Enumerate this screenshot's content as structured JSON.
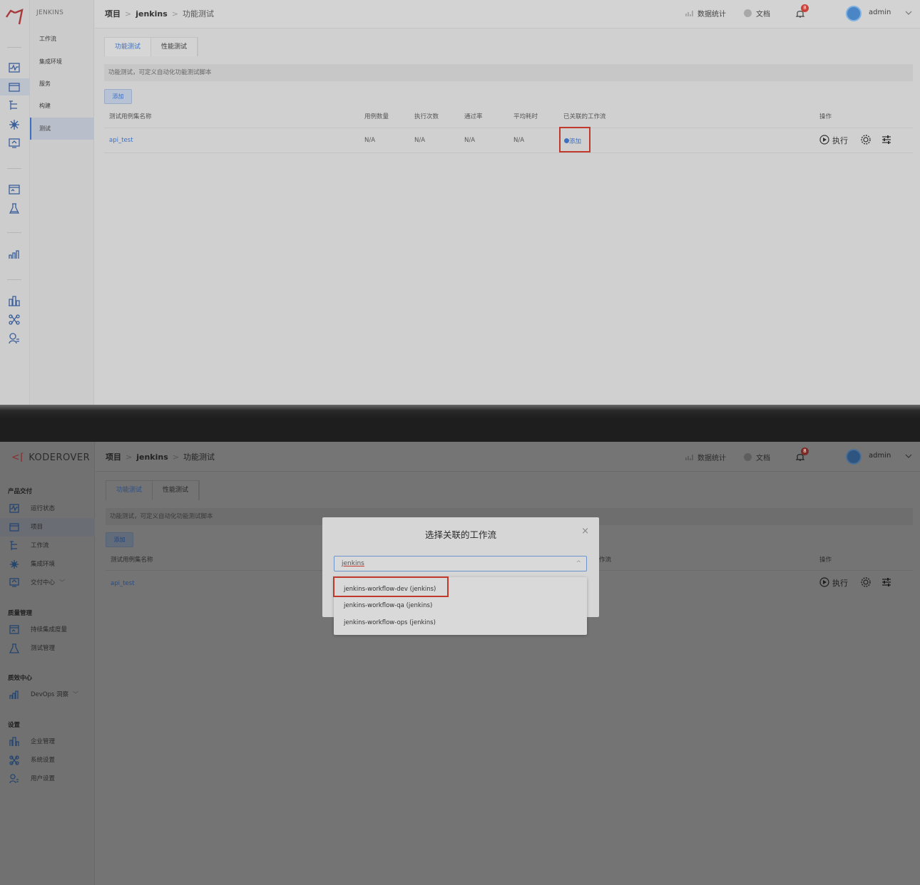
{
  "top": {
    "project_badge": "JENKINS",
    "sub_nav": [
      "工作流",
      "集成环境",
      "服务",
      "构建",
      "测试"
    ],
    "active_sub_nav": "测试",
    "breadcrumb": {
      "root": "项目",
      "project": "jenkins",
      "current": "功能测试"
    },
    "topbar": {
      "stats_label": "数据统计",
      "docs_label": "文档",
      "notification_count": "8",
      "user": "admin"
    },
    "tabs": [
      "功能测试",
      "性能测试"
    ],
    "description": "功能测试，可定义自动化功能测试脚本",
    "add_button": "添加",
    "table": {
      "headers": [
        "测试用例集名称",
        "用例数量",
        "执行次数",
        "通过率",
        "平均耗时",
        "已关联的工作流",
        "操作"
      ],
      "rows": [
        {
          "name": "api_test",
          "cases": "N/A",
          "runs": "N/A",
          "pass_rate": "N/A",
          "avg_time": "N/A",
          "workflow_action": "添加",
          "run_label": "执行"
        }
      ]
    }
  },
  "bottom": {
    "brand": "KODEROVER",
    "sections": [
      {
        "title": "产品交付",
        "items": [
          {
            "label": "运行状态",
            "icon": "pulse-icon"
          },
          {
            "label": "项目",
            "icon": "folder-icon",
            "active": true
          },
          {
            "label": "工作流",
            "icon": "workflow-icon"
          },
          {
            "label": "集成环境",
            "icon": "environment-icon"
          },
          {
            "label": "交付中心",
            "icon": "delivery-icon",
            "expandable": true
          }
        ]
      },
      {
        "title": "质量管理",
        "items": [
          {
            "label": "持续集成度量",
            "icon": "ci-metrics-icon"
          },
          {
            "label": "测试管理",
            "icon": "flask-icon"
          }
        ]
      },
      {
        "title": "质效中心",
        "items": [
          {
            "label": "DevOps 洞察",
            "icon": "insight-icon",
            "expandable": true
          }
        ]
      },
      {
        "title": "设置",
        "items": [
          {
            "label": "企业管理",
            "icon": "enterprise-icon"
          },
          {
            "label": "系统设置",
            "icon": "system-settings-icon"
          },
          {
            "label": "用户设置",
            "icon": "user-settings-icon"
          }
        ]
      }
    ],
    "breadcrumb": {
      "root": "项目",
      "project": "jenkins",
      "current": "功能测试"
    },
    "topbar": {
      "stats_label": "数据统计",
      "docs_label": "文档",
      "notification_count": "8",
      "user": "admin"
    },
    "tabs": [
      "功能测试",
      "性能测试"
    ],
    "description": "功能测试，可定义自动化功能测试脚本",
    "add_button": "添加",
    "table_header_name": "测试用例集名称",
    "table_header_partial": "作流",
    "table_header_ops": "操作",
    "row_name": "api_test",
    "run_label": "执行",
    "modal": {
      "title": "选择关联的工作流",
      "search_value": "jenkins",
      "options": [
        "jenkins-workflow-dev (jenkins)",
        "jenkins-workflow-qa (jenkins)",
        "jenkins-workflow-ops (jenkins)"
      ],
      "highlighted_option": 0
    }
  },
  "colors": {
    "accent": "#3e70c0",
    "highlight_box": "#c0392b",
    "badge": "#c9423a",
    "brand_mark": "#8e2c2c"
  }
}
